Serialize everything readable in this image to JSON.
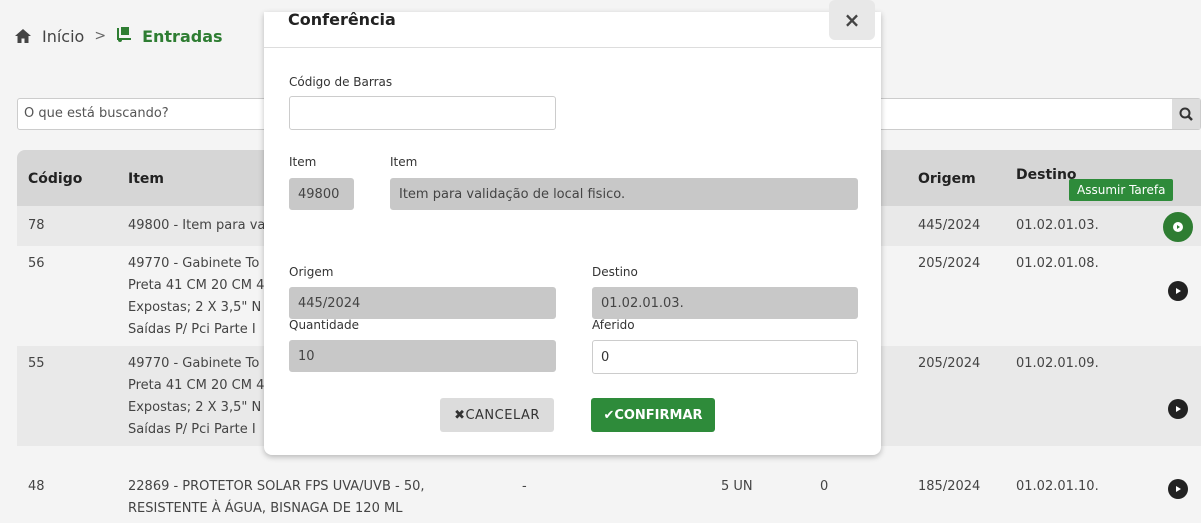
{
  "breadcrumb": {
    "home_label": "Início",
    "separator": ">",
    "current_label": "Entradas"
  },
  "search": {
    "placeholder": "O que está buscando?"
  },
  "table": {
    "headers": {
      "codigo": "Código",
      "item": "Item",
      "origem": "Origem",
      "destino": "Destino"
    },
    "assume_task_label": "Assumir Tarefa",
    "rows": [
      {
        "codigo": "78",
        "item_l1": "49800 - Item para va",
        "item_l2": "",
        "item_l3": "",
        "item_l4": "",
        "col3": "",
        "col4": "",
        "col5": "",
        "origem": "445/2024",
        "destino": "01.02.01.03."
      },
      {
        "codigo": "56",
        "item_l1": "49770 - Gabinete To",
        "item_l2": "Preta 41 CM 20 CM 4",
        "item_l3": "Expostas; 2 X 3,5\" N",
        "item_l4": "Saídas P/ Pci Parte I",
        "col3": "",
        "col4": "",
        "col5": "",
        "origem": "205/2024",
        "destino": "01.02.01.08."
      },
      {
        "codigo": "55",
        "item_l1": "49770 - Gabinete To",
        "item_l2": "Preta 41 CM 20 CM 4",
        "item_l3": "Expostas; 2 X 3,5\" N",
        "item_l4": "Saídas P/ Pci Parte I",
        "col3": "",
        "col4": "",
        "col5": "",
        "origem": "205/2024",
        "destino": "01.02.01.09."
      },
      {
        "codigo": "48",
        "item_l1": "22869 - PROTETOR SOLAR FPS UVA/UVB - 50,",
        "item_l2": "RESISTENTE À ÁGUA, BISNAGA DE 120 ML",
        "item_l3": "",
        "item_l4": "",
        "col3": "-",
        "col4": "5 UN",
        "col5": "0",
        "origem": "185/2024",
        "destino": "01.02.01.10."
      }
    ]
  },
  "modal": {
    "title": "Conferência",
    "close_symbol": "×",
    "barcode_label": "Código de Barras",
    "barcode_value": "",
    "item_code_label": "Item",
    "item_code_value": "49800",
    "item_desc_label": "Item",
    "item_desc_value": "Item para validação de local fisico.",
    "origem_label": "Origem",
    "origem_value": "445/2024",
    "destino_label": "Destino",
    "destino_value": "01.02.01.03.",
    "quantidade_label": "Quantidade",
    "quantidade_value": "10",
    "aferido_label": "Aferido",
    "aferido_value": "0",
    "cancel_label": "✖CANCELAR",
    "confirm_label": "✔CONFIRMAR"
  },
  "colors": {
    "accent_green": "#2e8b3a",
    "readonly_gray": "#c8c8c8",
    "header_gray": "#d6d6d6"
  }
}
